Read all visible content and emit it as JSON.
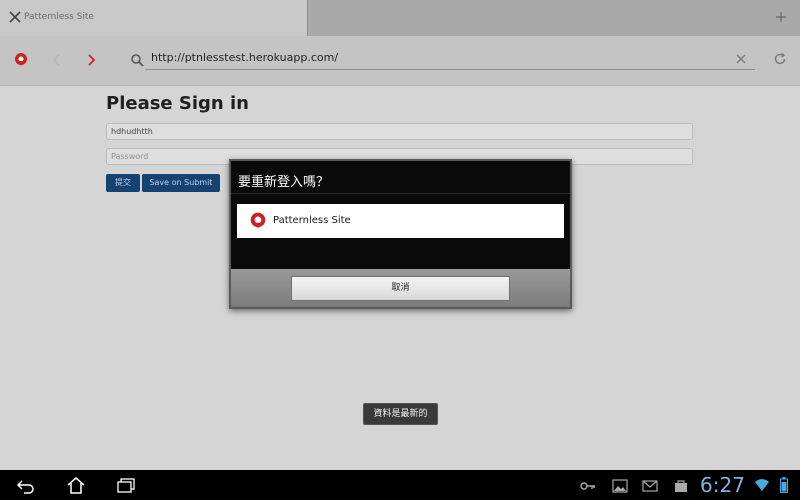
{
  "browser": {
    "tab": {
      "title": "Patternless Site"
    },
    "url": "http://ptnlesstest.herokuapp.com/"
  },
  "page": {
    "title": "Please Sign in",
    "username_value": "hdhudhtth",
    "password_placeholder": "Password",
    "submit_label": "提交",
    "save_label": "Save on Submit"
  },
  "dialog": {
    "title": "要重新登入嗎？",
    "account_label": "Patternless Site",
    "cancel_label": "取消"
  },
  "toast": {
    "message": "資料是最新的"
  },
  "status_bar": {
    "time": "6:27",
    "icons": [
      "key-icon",
      "image-icon",
      "mail-icon",
      "bag-icon",
      "wifi-icon",
      "battery-icon"
    ]
  },
  "colors": {
    "brand_red": "#cc2222",
    "button_blue": "#144273",
    "clock_blue": "#7fb3dd"
  }
}
